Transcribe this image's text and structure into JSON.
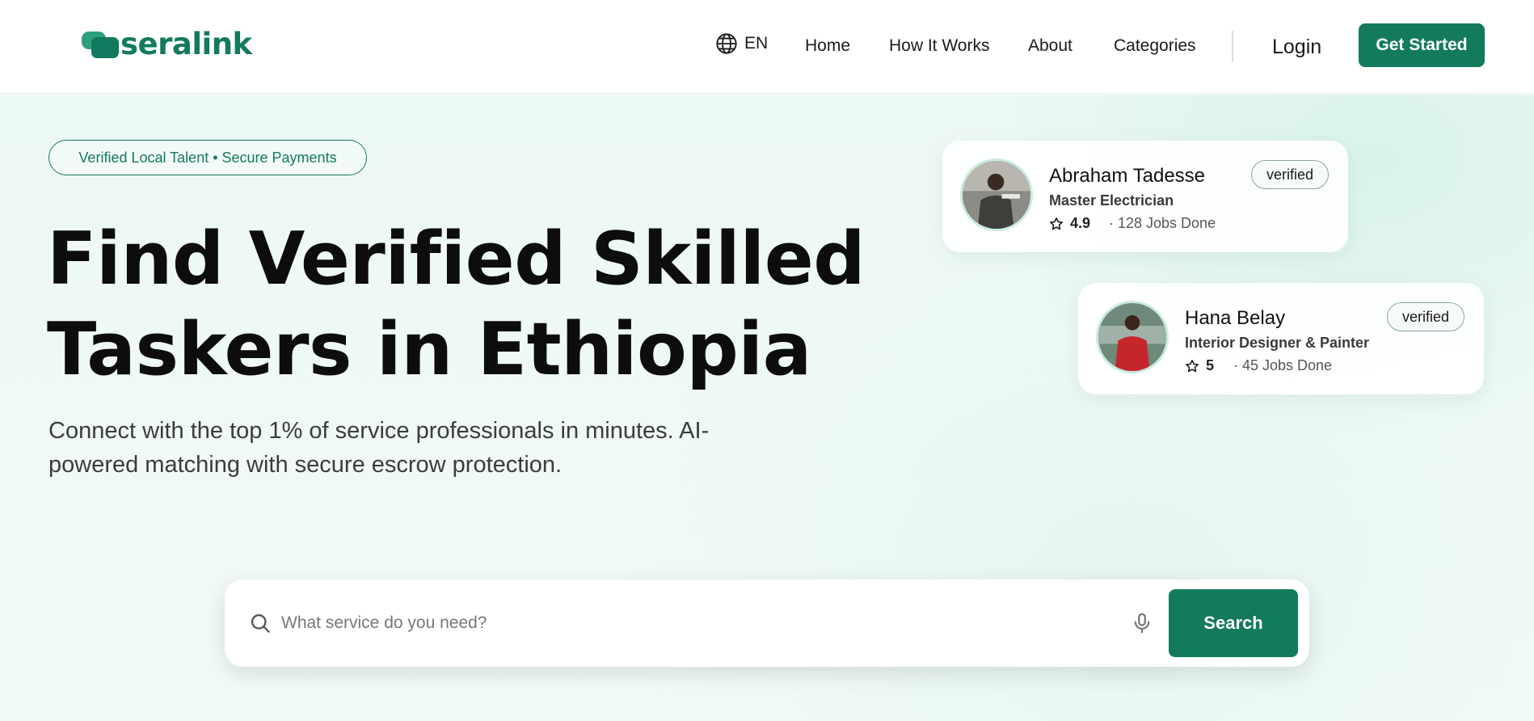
{
  "header": {
    "logo_text": "seralink",
    "language": "EN",
    "nav": [
      "Home",
      "How It Works",
      "About",
      "Categories"
    ],
    "login_label": "Login",
    "cta_label": "Get Started"
  },
  "hero": {
    "tagline": "Verified Local Talent • Secure Payments",
    "headline_line1": "Find Verified Skilled",
    "headline_line2": "Taskers in Ethiopia",
    "subtext": "Connect with the top 1% of service professionals in minutes. AI-powered matching with secure escrow protection."
  },
  "taskers": [
    {
      "name": "Abraham Tadesse",
      "role": "Master Electrician",
      "rating": "4.9",
      "jobs": "· 128 Jobs Done",
      "badge": "verified"
    },
    {
      "name": "Hana Belay",
      "role": "Interior Designer & Painter",
      "rating": "5",
      "jobs": "· 45 Jobs Done",
      "badge": "verified"
    }
  ],
  "search": {
    "placeholder": "What service do you need?",
    "button_label": "Search"
  },
  "colors": {
    "brand": "#137a5e",
    "brand_light": "#2e9e7f",
    "hero_bg": "#ecf8f4"
  },
  "icons": {
    "language": "globe-icon",
    "rating": "star-outline-icon",
    "search": "search-icon",
    "voice": "microphone-icon"
  }
}
